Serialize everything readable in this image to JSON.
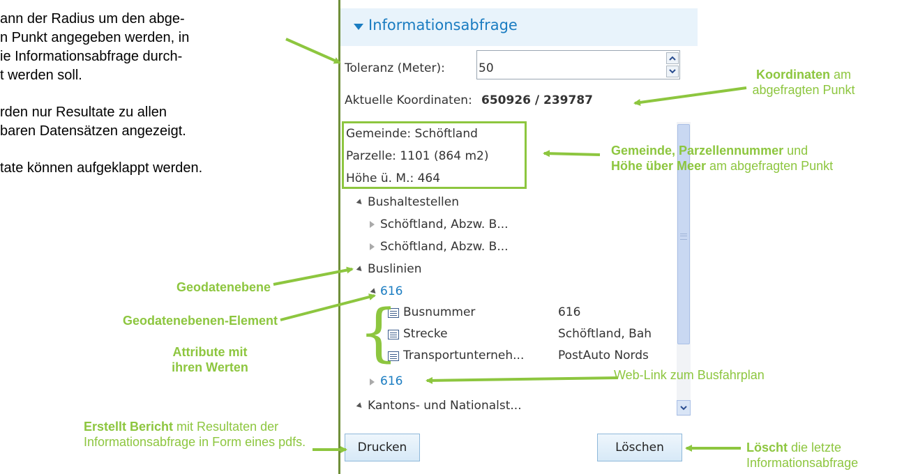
{
  "left_text": {
    "line1": "ann der Radius um den abge-",
    "line2": "n Punkt angegeben werden, in",
    "line3": "ie Informationsabfrage durch-",
    "line4": "t werden soll.",
    "line5": "rden nur Resultate zu allen",
    "line6": "baren Datensätzen angezeigt.",
    "line7": "tate können aufgeklappt werden."
  },
  "panel": {
    "title": "Informationsabfrage",
    "tolerance_label": "Toleranz (Meter):",
    "tolerance_value": "50",
    "coords_label": "Aktuelle Koordinaten:",
    "coords_value": "650926 / 239787",
    "gemeinde": "Gemeinde: Schöftland",
    "parzelle": "Parzelle: 1101 (864 m2)",
    "hoehe": "Höhe ü. M.: 464",
    "tree": {
      "bushaltestellen": "Bushaltestellen",
      "stop1": "Schöftland, Abzw. B...",
      "stop2": "Schöftland, Abzw. B...",
      "buslinien": "Buslinien",
      "line_616": "616",
      "attrs": [
        {
          "name": "Busnummer",
          "value": "616"
        },
        {
          "name": "Strecke",
          "value": "Schöftland, Bah"
        },
        {
          "name": "Transportunterneh...",
          "value": "PostAuto Nords"
        }
      ],
      "link_616": "616",
      "kantons": "Kantons- und Nationalst..."
    },
    "print_button": "Drucken",
    "delete_button": "Löschen"
  },
  "annotations": {
    "koordinaten_bold": "Koordinaten",
    "koordinaten_rest": " am",
    "koordinaten_line2": "abgefragten Punkt",
    "gemeinde_bold": "Gemeinde, Parzellennummer",
    "gemeinde_rest": " und",
    "hoehe_bold": "Höhe über Meer",
    "hoehe_rest": " am abgefragten Punkt",
    "geodatenebene": "Geodatenebene",
    "geodatenebenen_element": "Geodatenebenen-Element",
    "attribute_line1": "Attribute mit",
    "attribute_line2": "ihren Werten",
    "weblink": "Web-Link zum Busfahrplan",
    "bericht_bold": "Erstellt Bericht",
    "bericht_rest": " mit Resultaten der",
    "bericht_line2": "Informationsabfrage in Form eines pdfs.",
    "loescht_bold": "Löscht",
    "loescht_rest": " die letzte",
    "loescht_line2": "Informationsabfrage"
  },
  "colors": {
    "annotation_green": "#8dc63f",
    "link_blue": "#1a7cc1",
    "header_bg": "#e8f3fb"
  }
}
